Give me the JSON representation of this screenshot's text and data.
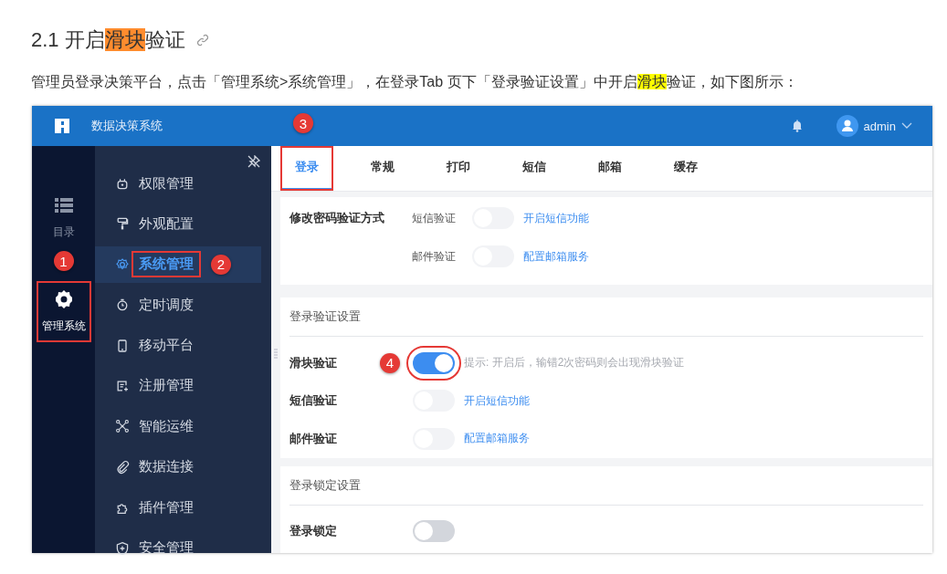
{
  "heading": {
    "number": "2.1",
    "before": "开启",
    "highlight": "滑块",
    "after": "验证"
  },
  "intro": {
    "before": "管理员登录决策平台，点击「管理系统>系统管理」，在登录Tab 页下「登录验证设置」中开启",
    "highlight": "滑块",
    "after": "验证，如下图所示："
  },
  "app": {
    "title": "数据决策系统",
    "user": "admin",
    "rail": [
      {
        "label": "目录",
        "selected": false
      },
      {
        "label": "管理系统",
        "selected": true,
        "annotation": "1"
      }
    ],
    "nav": [
      {
        "label": "权限管理",
        "selected": false
      },
      {
        "label": "外观配置",
        "selected": false
      },
      {
        "label": "系统管理",
        "selected": true,
        "annotation": "2"
      },
      {
        "label": "定时调度",
        "selected": false
      },
      {
        "label": "移动平台",
        "selected": false
      },
      {
        "label": "注册管理",
        "selected": false
      },
      {
        "label": "智能运维",
        "selected": false
      },
      {
        "label": "数据连接",
        "selected": false
      },
      {
        "label": "插件管理",
        "selected": false
      },
      {
        "label": "安全管理",
        "selected": false
      }
    ],
    "tabs": [
      {
        "label": "登录",
        "selected": true,
        "annotation": "3"
      },
      {
        "label": "常规",
        "selected": false
      },
      {
        "label": "打印",
        "selected": false
      },
      {
        "label": "短信",
        "selected": false
      },
      {
        "label": "邮箱",
        "selected": false
      },
      {
        "label": "缓存",
        "selected": false
      }
    ],
    "password_section": {
      "label": "修改密码验证方式",
      "rows": [
        {
          "label": "短信验证",
          "on": false,
          "disabled": true,
          "link": "开启短信功能"
        },
        {
          "label": "邮件验证",
          "on": false,
          "disabled": true,
          "link": "配置邮箱服务"
        }
      ]
    },
    "sections": [
      {
        "title": "登录验证设置",
        "rows": [
          {
            "label": "滑块验证",
            "on": true,
            "disabled": false,
            "annotation": "4",
            "hint": "提示: 开启后，输错2次密码则会出现滑块验证"
          },
          {
            "label": "短信验证",
            "on": false,
            "disabled": true,
            "link": "开启短信功能"
          },
          {
            "label": "邮件验证",
            "on": false,
            "disabled": true,
            "link": "配置邮箱服务"
          }
        ]
      },
      {
        "title": "登录锁定设置",
        "rows": [
          {
            "label": "登录锁定",
            "on": false,
            "disabled": false
          }
        ]
      }
    ]
  }
}
